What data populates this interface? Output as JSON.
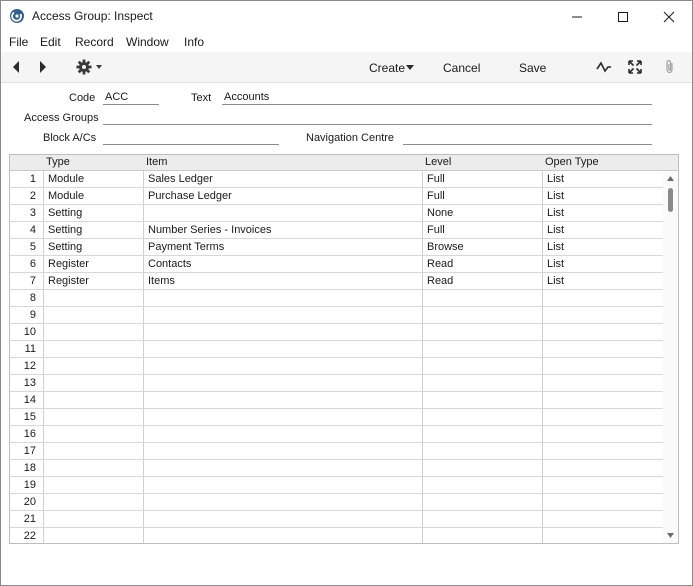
{
  "window": {
    "title": "Access Group: Inspect"
  },
  "menu": [
    "File",
    "Edit",
    "Record",
    "Window",
    "Info"
  ],
  "toolbar": {
    "create_label": "Create",
    "cancel_label": "Cancel",
    "save_label": "Save"
  },
  "form": {
    "code_label": "Code",
    "code_value": "ACC",
    "text_label": "Text",
    "text_value": "Accounts",
    "access_groups_label": "Access Groups",
    "access_groups_value": "",
    "block_acs_label": "Block A/Cs",
    "block_acs_value": "",
    "navigation_centre_label": "Navigation Centre",
    "navigation_centre_value": ""
  },
  "grid": {
    "columns": [
      "Type",
      "Item",
      "Level",
      "Open Type"
    ],
    "rows": [
      {
        "num": "1",
        "type": "Module",
        "item": "Sales Ledger",
        "level": "Full",
        "open_type": "List"
      },
      {
        "num": "2",
        "type": "Module",
        "item": "Purchase Ledger",
        "level": "Full",
        "open_type": "List"
      },
      {
        "num": "3",
        "type": "Setting",
        "item": "",
        "level": "None",
        "open_type": "List"
      },
      {
        "num": "4",
        "type": "Setting",
        "item": "Number Series - Invoices",
        "level": "Full",
        "open_type": "List"
      },
      {
        "num": "5",
        "type": "Setting",
        "item": "Payment Terms",
        "level": "Browse",
        "open_type": "List"
      },
      {
        "num": "6",
        "type": "Register",
        "item": "Contacts",
        "level": "Read",
        "open_type": "List"
      },
      {
        "num": "7",
        "type": "Register",
        "item": "Items",
        "level": "Read",
        "open_type": "List"
      },
      {
        "num": "8",
        "type": "",
        "item": "",
        "level": "",
        "open_type": ""
      },
      {
        "num": "9",
        "type": "",
        "item": "",
        "level": "",
        "open_type": ""
      },
      {
        "num": "10",
        "type": "",
        "item": "",
        "level": "",
        "open_type": ""
      },
      {
        "num": "11",
        "type": "",
        "item": "",
        "level": "",
        "open_type": ""
      },
      {
        "num": "12",
        "type": "",
        "item": "",
        "level": "",
        "open_type": ""
      },
      {
        "num": "13",
        "type": "",
        "item": "",
        "level": "",
        "open_type": ""
      },
      {
        "num": "14",
        "type": "",
        "item": "",
        "level": "",
        "open_type": ""
      },
      {
        "num": "15",
        "type": "",
        "item": "",
        "level": "",
        "open_type": ""
      },
      {
        "num": "16",
        "type": "",
        "item": "",
        "level": "",
        "open_type": ""
      },
      {
        "num": "17",
        "type": "",
        "item": "",
        "level": "",
        "open_type": ""
      },
      {
        "num": "18",
        "type": "",
        "item": "",
        "level": "",
        "open_type": ""
      },
      {
        "num": "19",
        "type": "",
        "item": "",
        "level": "",
        "open_type": ""
      },
      {
        "num": "20",
        "type": "",
        "item": "",
        "level": "",
        "open_type": ""
      },
      {
        "num": "21",
        "type": "",
        "item": "",
        "level": "",
        "open_type": ""
      },
      {
        "num": "22",
        "type": "",
        "item": "",
        "level": "",
        "open_type": ""
      }
    ]
  },
  "icons": {
    "app": "app-logo-icon",
    "back": "back-arrow-icon",
    "forward": "forward-arrow-icon",
    "actions": "gear-icon",
    "activity": "pulse-icon",
    "fullscreen": "expand-icon",
    "attach": "paperclip-icon"
  },
  "colors": {
    "toolbar_bg": "#f5f5f5",
    "grid_header_bg": "#ececec",
    "app_icon": "#2f5f8f"
  }
}
